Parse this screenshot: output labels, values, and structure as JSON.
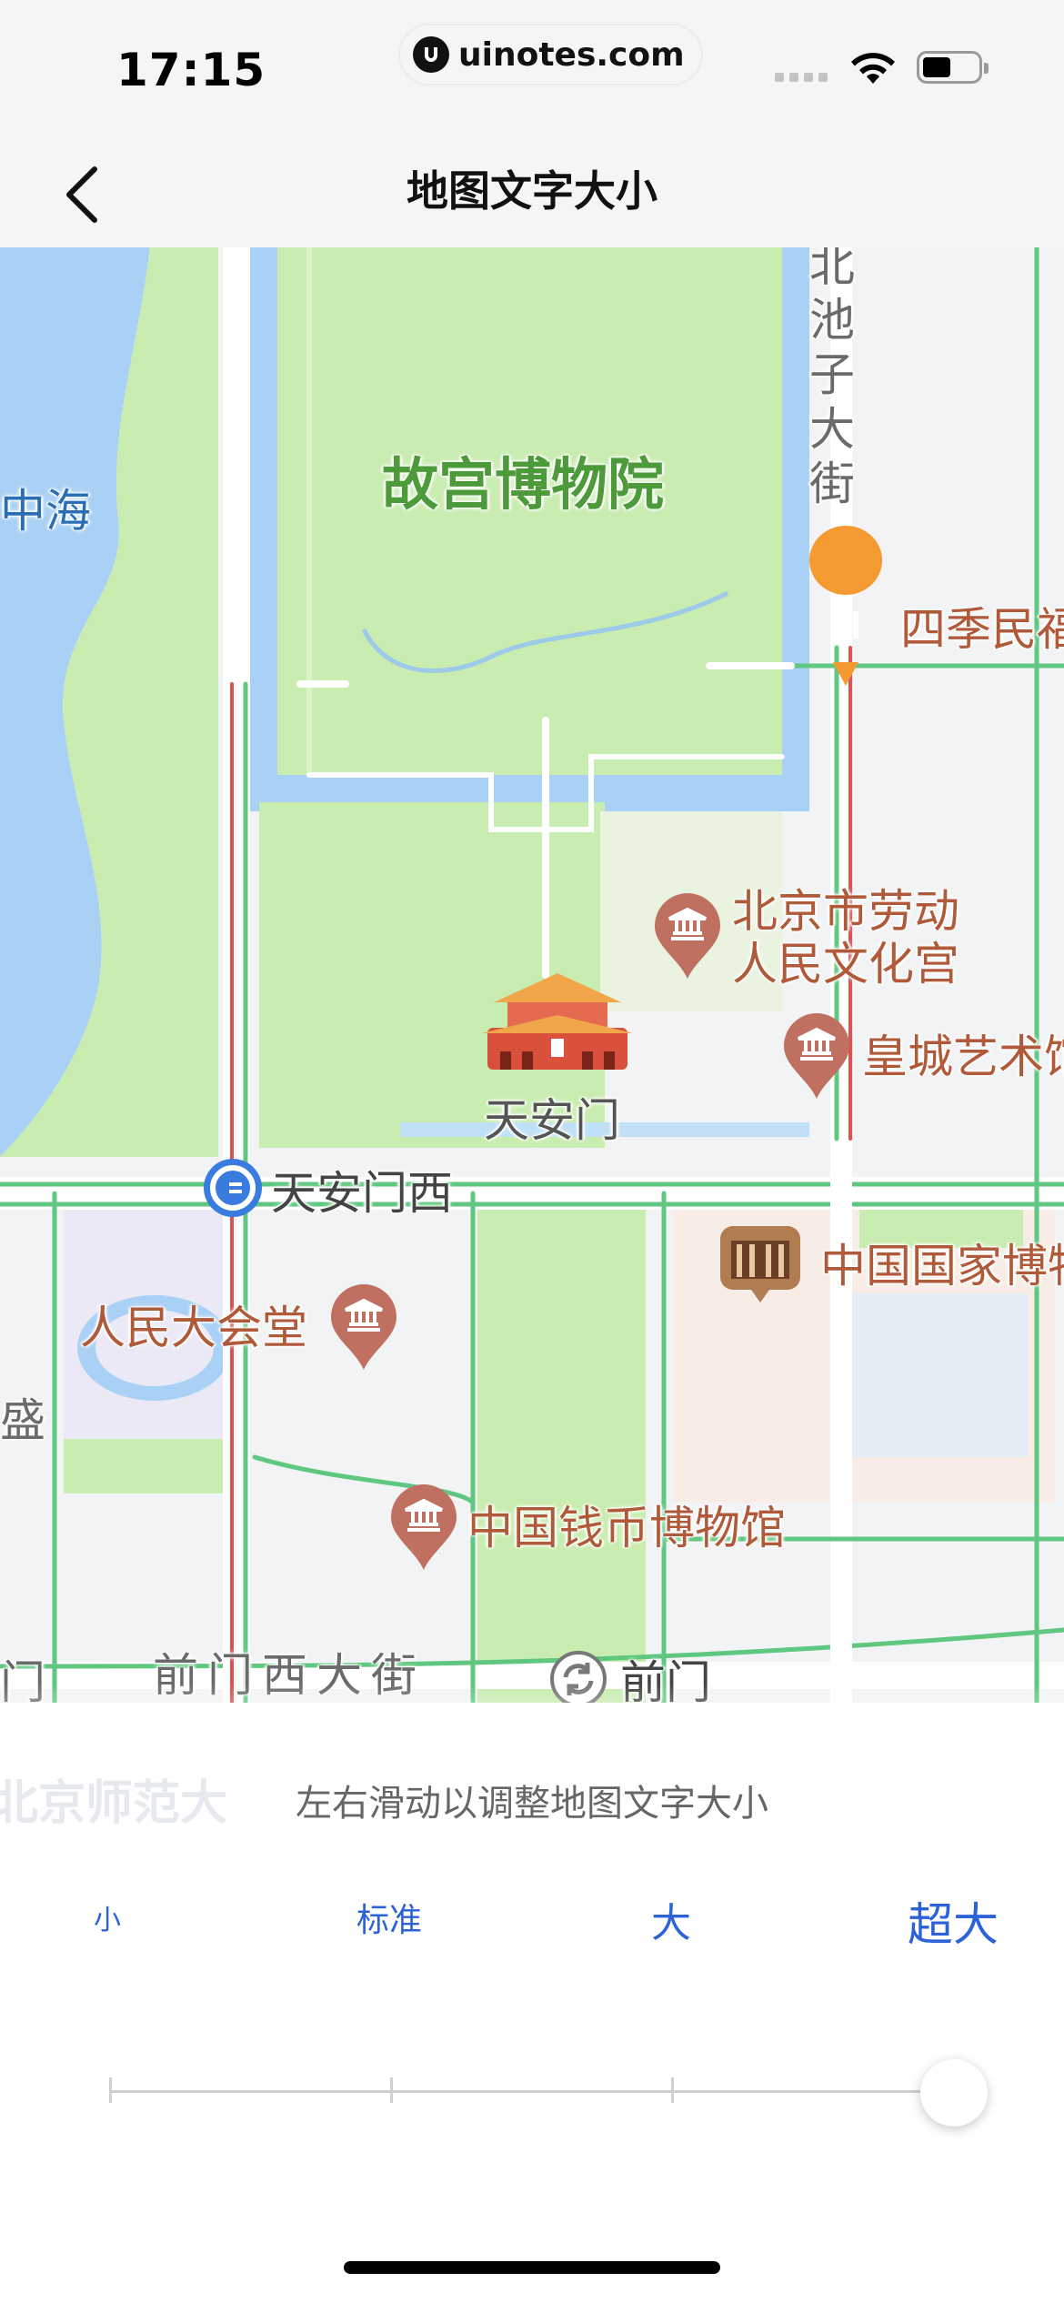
{
  "status_bar": {
    "time": "17:15",
    "url": "uinotes.com"
  },
  "nav": {
    "title": "地图文字大小",
    "back_icon": "chevron-left-icon"
  },
  "map": {
    "park_label": "故宫博物院",
    "water_label": "中海",
    "road_label_north": "北池子大街",
    "road_label_south": "前门西大街",
    "edge_label": "盛",
    "edge_label_2": "门",
    "pois": {
      "restaurant": "四季民福",
      "palace_a": "北京市劳动",
      "palace_b": "人民文化宫",
      "art": "皇城艺术馆",
      "tiananmen": "天安门",
      "subway": "天安门西",
      "museum": "中国国家博物馆",
      "hall": "人民大会堂",
      "coin": "中国钱币博物馆",
      "qianmen": "前门"
    },
    "colors": {
      "water": "#a9d0f5",
      "park": "#c9ecb0",
      "road_green": "#5fc77f",
      "road_red": "#e05050",
      "poi": "#b05a3a"
    }
  },
  "panel": {
    "ghost_label": "北京师范大",
    "hint": "左右滑动以调整地图文字大小",
    "options": [
      "小",
      "标准",
      "大",
      "超大"
    ],
    "selected_index": 3,
    "accent": "#2b62d8"
  }
}
